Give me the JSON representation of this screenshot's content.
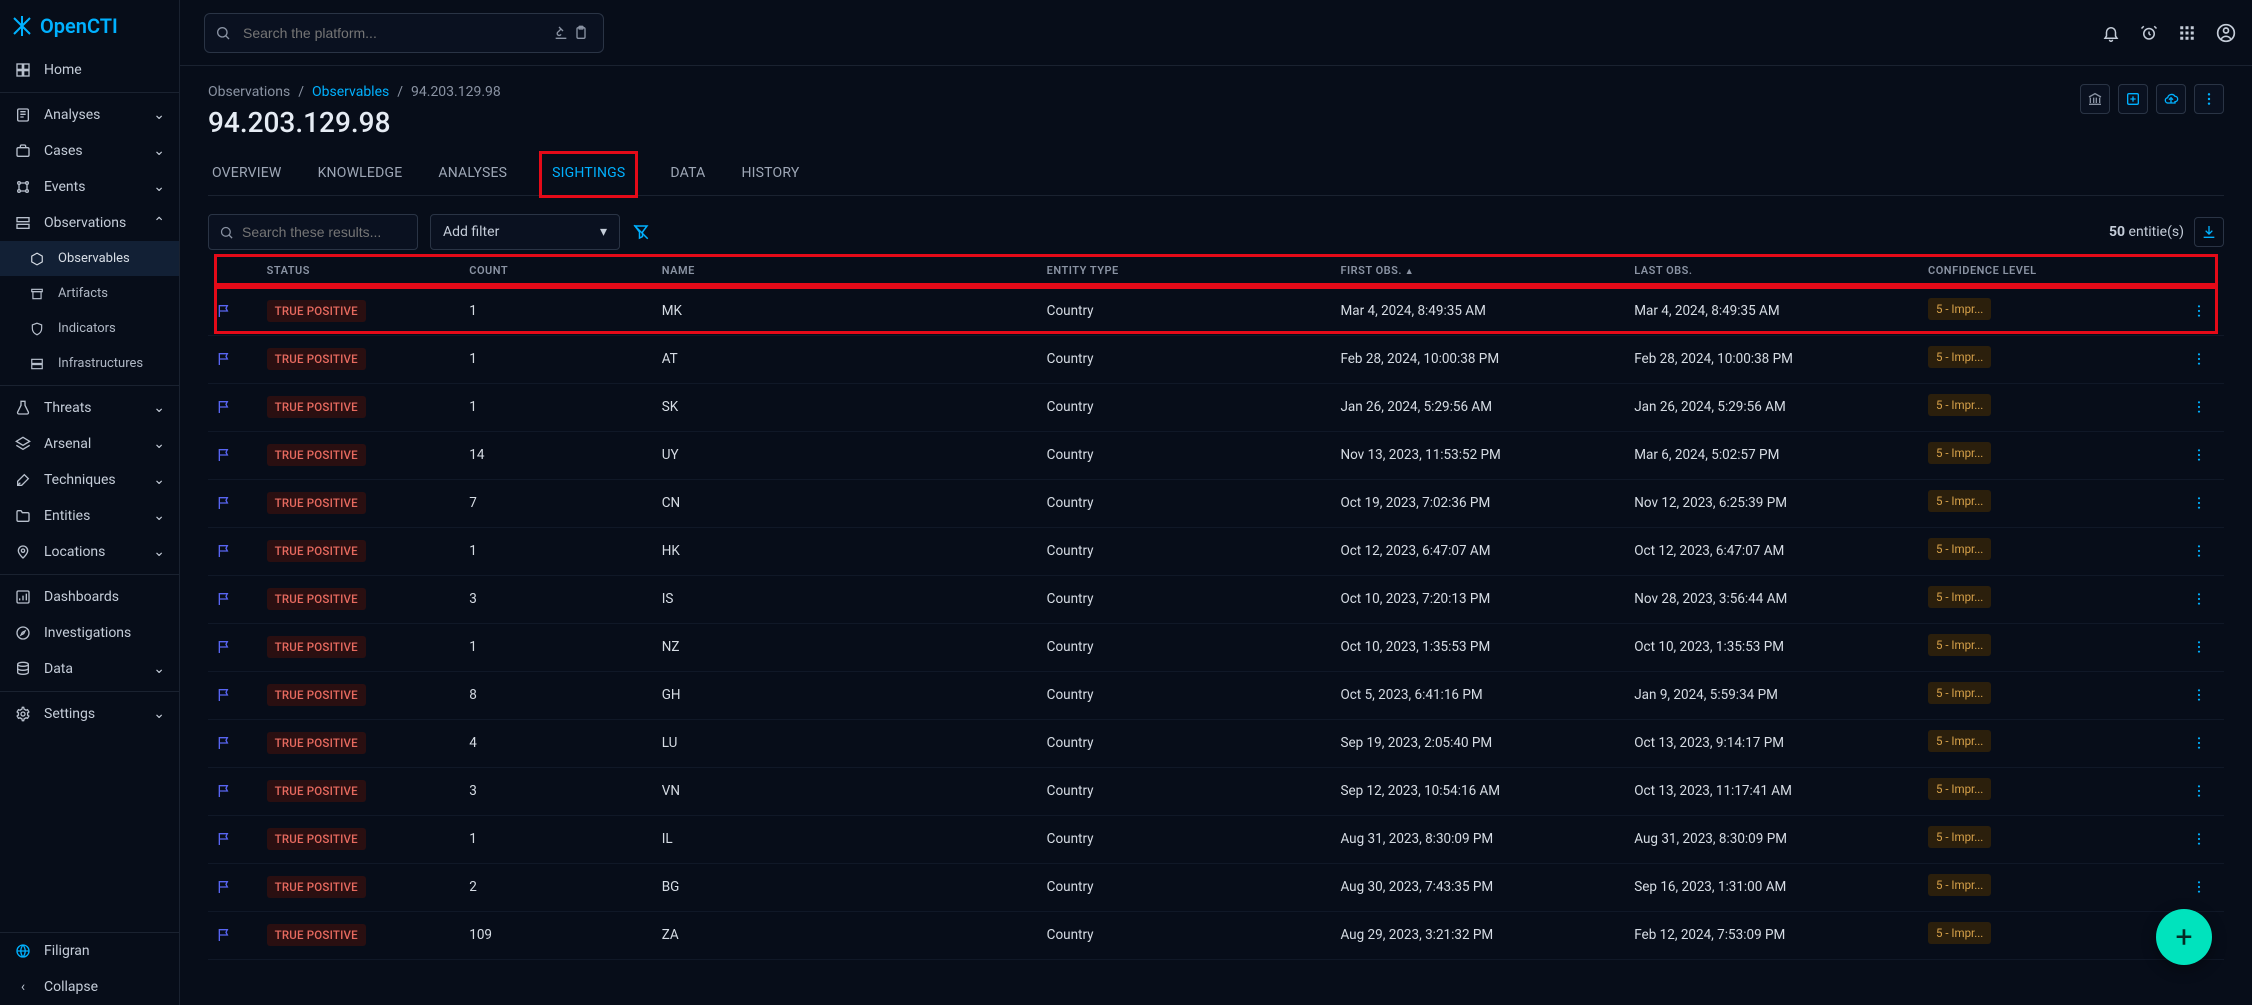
{
  "brand": "OpenCTI",
  "search": {
    "placeholder": "Search the platform..."
  },
  "sidebar": {
    "home": "Home",
    "items": [
      {
        "label": "Analyses"
      },
      {
        "label": "Cases"
      },
      {
        "label": "Events"
      },
      {
        "label": "Observations"
      }
    ],
    "obs_sub": [
      {
        "label": "Observables",
        "active": true
      },
      {
        "label": "Artifacts"
      },
      {
        "label": "Indicators"
      },
      {
        "label": "Infrastructures"
      }
    ],
    "items2": [
      {
        "label": "Threats"
      },
      {
        "label": "Arsenal"
      },
      {
        "label": "Techniques"
      },
      {
        "label": "Entities"
      },
      {
        "label": "Locations"
      }
    ],
    "items3": [
      {
        "label": "Dashboards"
      },
      {
        "label": "Investigations"
      },
      {
        "label": "Data"
      }
    ],
    "items4": [
      {
        "label": "Settings"
      }
    ],
    "footer": {
      "filigran": "Filigran",
      "collapse": "Collapse"
    }
  },
  "breadcrumb": {
    "root": "Observations",
    "link": "Observables",
    "current": "94.203.129.98"
  },
  "page_title": "94.203.129.98",
  "tabs": [
    {
      "label": "OVERVIEW"
    },
    {
      "label": "KNOWLEDGE"
    },
    {
      "label": "ANALYSES"
    },
    {
      "label": "SIGHTINGS",
      "active": true
    },
    {
      "label": "DATA"
    },
    {
      "label": "HISTORY"
    }
  ],
  "results_search": {
    "placeholder": "Search these results..."
  },
  "add_filter": "Add filter",
  "entities_count_num": "50",
  "entities_count_label": "entitie(s)",
  "columns": {
    "status": "STATUS",
    "count": "COUNT",
    "name": "NAME",
    "entity_type": "ENTITY TYPE",
    "first_obs": "FIRST OBS.",
    "last_obs": "LAST OBS.",
    "confidence": "CONFIDENCE LEVEL"
  },
  "status_label": "TRUE POSITIVE",
  "confidence_label": "5 - Impr...",
  "rows": [
    {
      "count": "1",
      "name": "MK",
      "et": "Country",
      "fo": "Mar 4, 2024, 8:49:35 AM",
      "lo": "Mar 4, 2024, 8:49:35 AM"
    },
    {
      "count": "1",
      "name": "AT",
      "et": "Country",
      "fo": "Feb 28, 2024, 10:00:38 PM",
      "lo": "Feb 28, 2024, 10:00:38 PM"
    },
    {
      "count": "1",
      "name": "SK",
      "et": "Country",
      "fo": "Jan 26, 2024, 5:29:56 AM",
      "lo": "Jan 26, 2024, 5:29:56 AM"
    },
    {
      "count": "14",
      "name": "UY",
      "et": "Country",
      "fo": "Nov 13, 2023, 11:53:52 PM",
      "lo": "Mar 6, 2024, 5:02:57 PM"
    },
    {
      "count": "7",
      "name": "CN",
      "et": "Country",
      "fo": "Oct 19, 2023, 7:02:36 PM",
      "lo": "Nov 12, 2023, 6:25:39 PM"
    },
    {
      "count": "1",
      "name": "HK",
      "et": "Country",
      "fo": "Oct 12, 2023, 6:47:07 AM",
      "lo": "Oct 12, 2023, 6:47:07 AM"
    },
    {
      "count": "3",
      "name": "IS",
      "et": "Country",
      "fo": "Oct 10, 2023, 7:20:13 PM",
      "lo": "Nov 28, 2023, 3:56:44 AM"
    },
    {
      "count": "1",
      "name": "NZ",
      "et": "Country",
      "fo": "Oct 10, 2023, 1:35:53 PM",
      "lo": "Oct 10, 2023, 1:35:53 PM"
    },
    {
      "count": "8",
      "name": "GH",
      "et": "Country",
      "fo": "Oct 5, 2023, 6:41:16 PM",
      "lo": "Jan 9, 2024, 5:59:34 PM"
    },
    {
      "count": "4",
      "name": "LU",
      "et": "Country",
      "fo": "Sep 19, 2023, 2:05:40 PM",
      "lo": "Oct 13, 2023, 9:14:17 PM"
    },
    {
      "count": "3",
      "name": "VN",
      "et": "Country",
      "fo": "Sep 12, 2023, 10:54:16 AM",
      "lo": "Oct 13, 2023, 11:17:41 AM"
    },
    {
      "count": "1",
      "name": "IL",
      "et": "Country",
      "fo": "Aug 31, 2023, 8:30:09 PM",
      "lo": "Aug 31, 2023, 8:30:09 PM"
    },
    {
      "count": "2",
      "name": "BG",
      "et": "Country",
      "fo": "Aug 30, 2023, 7:43:35 PM",
      "lo": "Sep 16, 2023, 1:31:00 AM"
    },
    {
      "count": "109",
      "name": "ZA",
      "et": "Country",
      "fo": "Aug 29, 2023, 3:21:32 PM",
      "lo": "Feb 12, 2024, 7:53:09 PM"
    }
  ]
}
